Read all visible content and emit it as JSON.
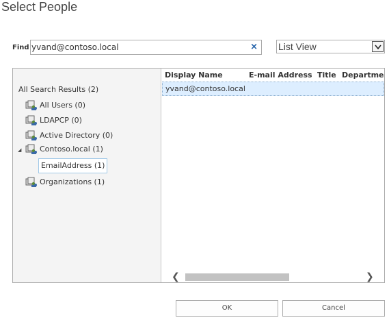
{
  "dialog": {
    "title": "Select People"
  },
  "find": {
    "label": "Find",
    "value": "yvand@contoso.local",
    "clear_glyph": "×"
  },
  "view": {
    "selected": "List View"
  },
  "tree": {
    "root_label": "All Search Results (2)",
    "nodes": [
      {
        "label": "All Users (0)",
        "icon": "directory-group-icon"
      },
      {
        "label": "LDAPCP (0)",
        "icon": "directory-group-icon"
      },
      {
        "label": "Active Directory (0)",
        "icon": "directory-group-icon"
      },
      {
        "label": "Contoso.local (1)",
        "icon": "directory-group-icon",
        "expanded": true,
        "children": [
          {
            "label": "EmailAddress (1)",
            "selected": true
          }
        ]
      },
      {
        "label": "Organizations (1)",
        "icon": "directory-group-icon"
      }
    ]
  },
  "list": {
    "columns": [
      "Display Name",
      "E-mail Address",
      "Title",
      "Department"
    ],
    "rows": [
      {
        "display_name": "yvand@contoso.local"
      }
    ]
  },
  "scroll": {
    "left_glyph": "❮",
    "right_glyph": "❯"
  },
  "buttons": {
    "ok": "OK",
    "cancel": "Cancel"
  }
}
